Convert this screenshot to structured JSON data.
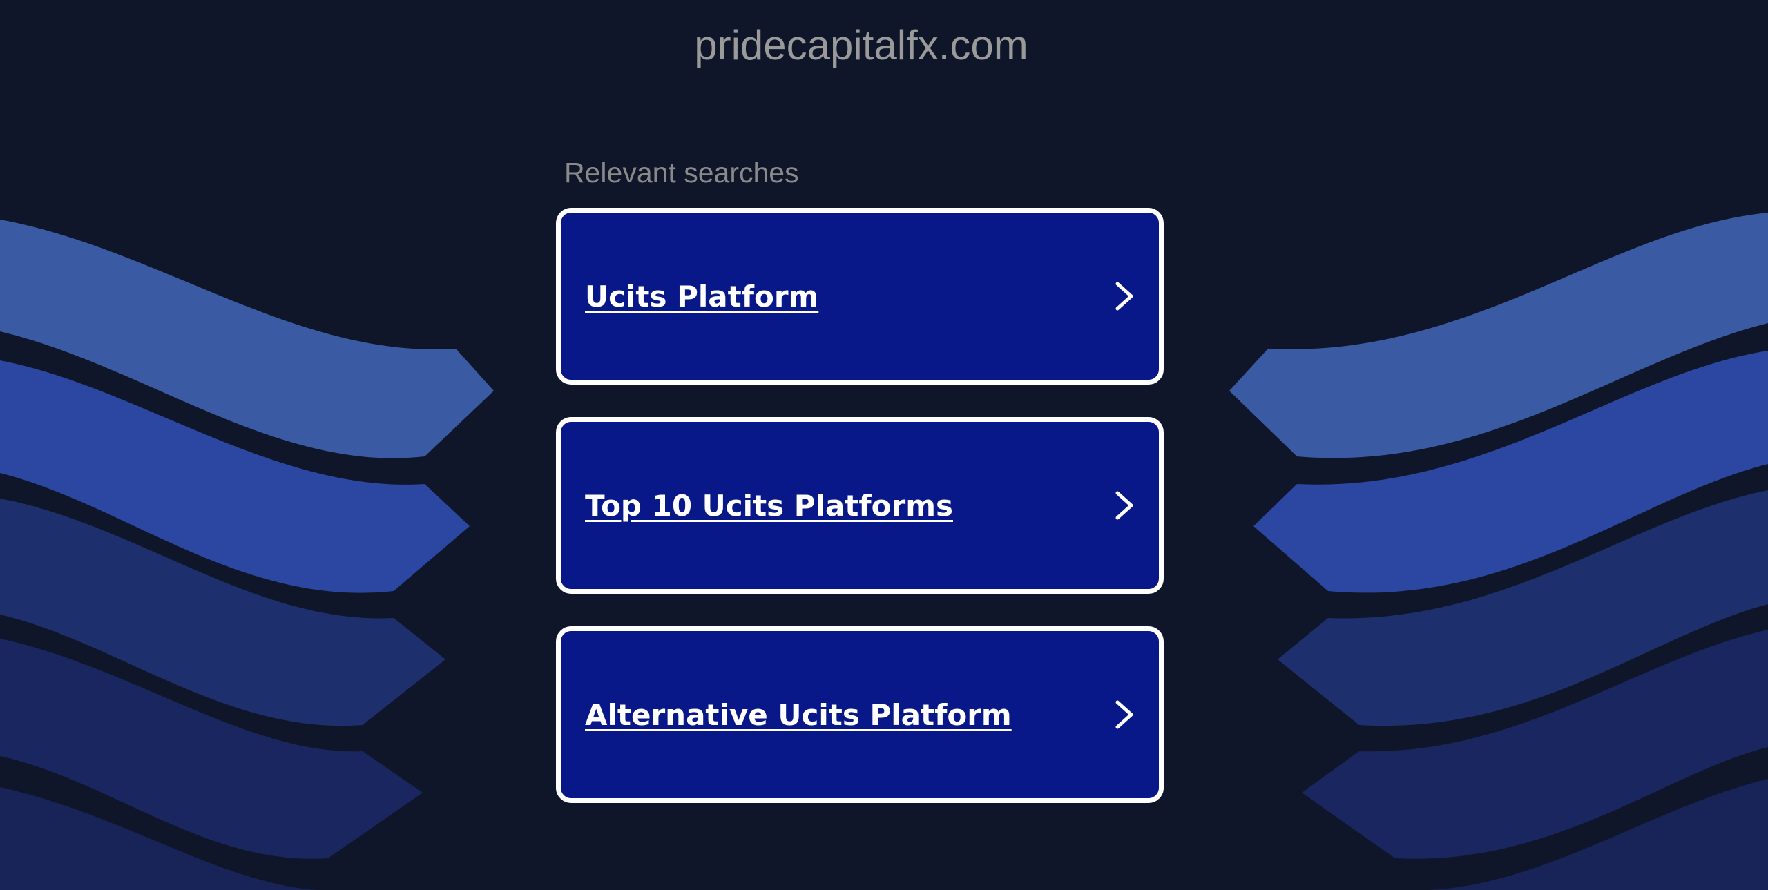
{
  "page": {
    "domain": "pridecapitalfx.com",
    "searches_heading": "Relevant searches"
  },
  "results": [
    {
      "label": "Ucits Platform",
      "icon": "chevron-right-icon"
    },
    {
      "label": "Top 10 Ucits Platforms",
      "icon": "chevron-right-icon"
    },
    {
      "label": "Alternative Ucits Platform",
      "icon": "chevron-right-icon"
    }
  ],
  "colors": {
    "background": "#10162a",
    "card_background": "#081889",
    "card_border": "#ffffff",
    "wave_light": "#3a5aa3",
    "wave_bright": "#2c47a2",
    "wave_mid": "#1e2f6e",
    "wave_dark": "#1a2660",
    "wave_darkest": "#182358"
  }
}
